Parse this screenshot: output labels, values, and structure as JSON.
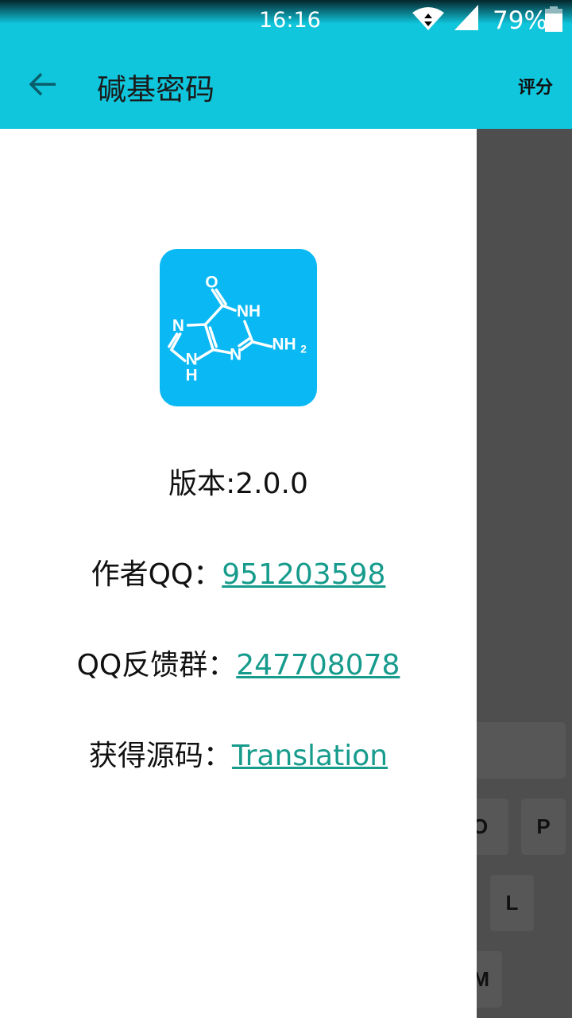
{
  "status_bar": {
    "time": "16:16",
    "battery": "79%",
    "icons": [
      "wifi-icon",
      "signal-icon",
      "battery-icon"
    ]
  },
  "app_bar": {
    "back_icon": "arrow-left-icon",
    "title": "碱基密码",
    "rate_label": "评分"
  },
  "logo": {
    "atoms": {
      "o": "O",
      "nh_top": "NH",
      "nh2": "NH",
      "nh2_sub": "2",
      "n_right": "N",
      "n_left": "N",
      "nh_bottom_n": "N",
      "nh_bottom_h": "H"
    }
  },
  "about": {
    "version": "版本:2.0.0",
    "author_label": "作者QQ：",
    "author_qq": "951203598",
    "group_label": "QQ反馈群：",
    "group_qq": "247708078",
    "source_label": "获得源码：",
    "source_link": "Translation"
  },
  "keyboard": {
    "keys": [
      "O",
      "P",
      "L",
      "M"
    ]
  },
  "colors": {
    "accent": "#10c6dc",
    "link": "#169b8c",
    "logo_bg": "#0ab8f4",
    "scrim": "#4e4e4e"
  }
}
